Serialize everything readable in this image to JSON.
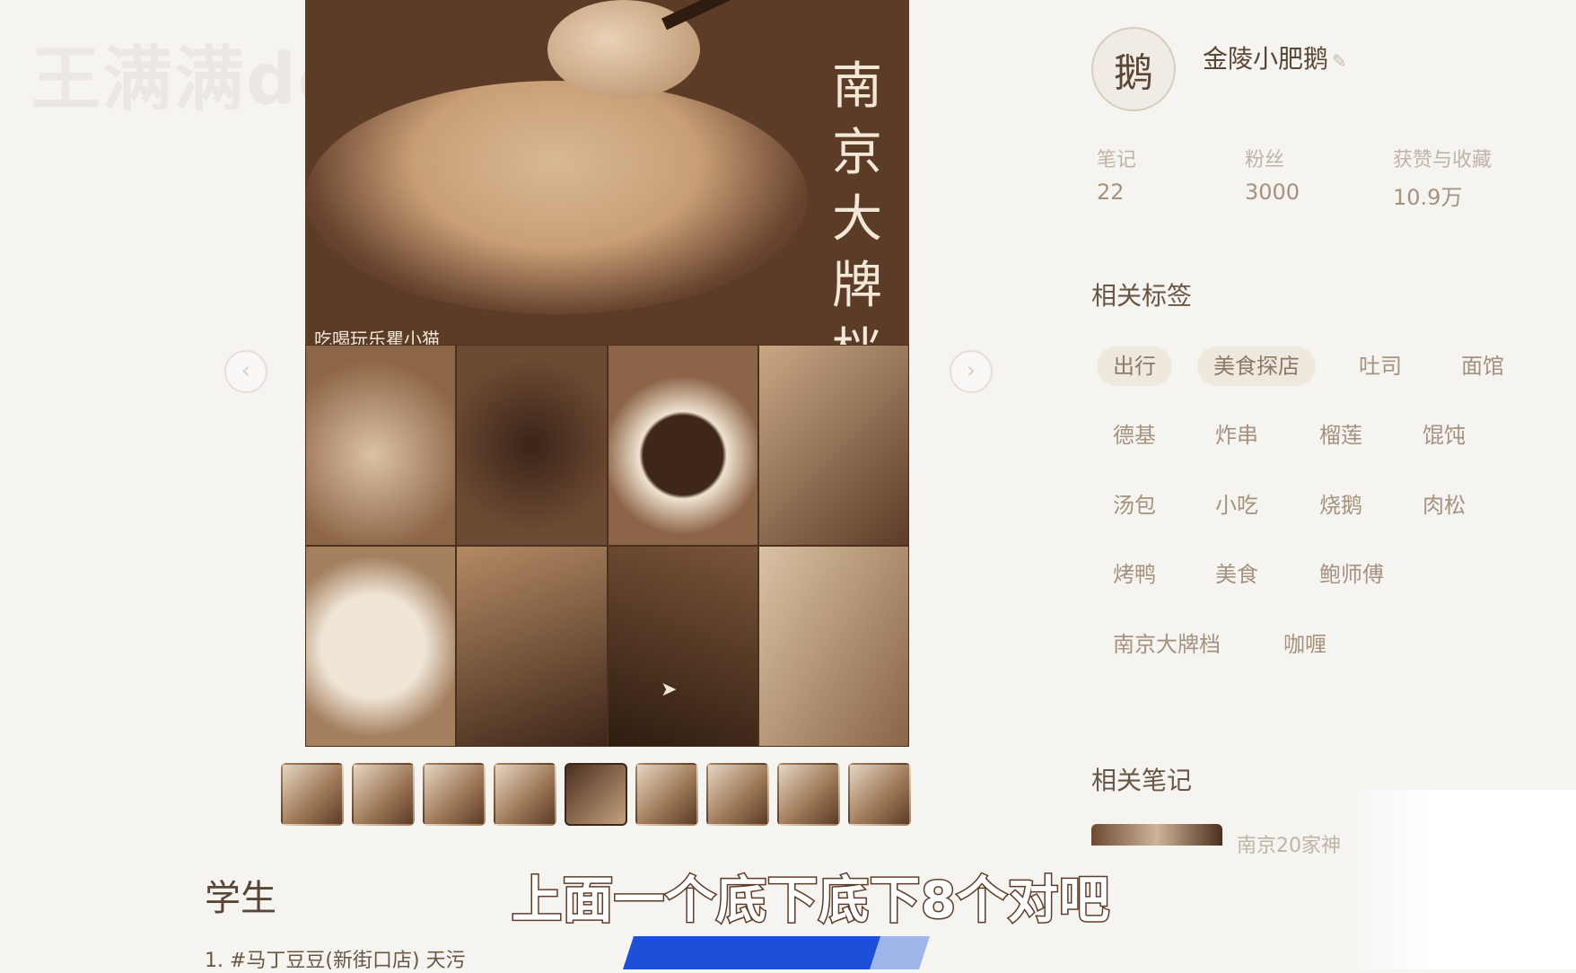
{
  "watermark": "王满满de",
  "main_image": {
    "title_vertical": "南京大牌档",
    "subtitle": "吃喝玩乐瞿小猫"
  },
  "nav": {
    "prev": "‹",
    "next": "›"
  },
  "thumbnails": {
    "count": 9,
    "active_index": 4
  },
  "note": {
    "title": "学生",
    "body_line1": "1. #马丁豆豆(新街口店) 天污"
  },
  "caption": "上面一个底下底下8个对吧",
  "author": {
    "name": "金陵小肥鹅",
    "avatar_glyph": "鹅",
    "verified_icon": "✎"
  },
  "stats": [
    {
      "label": "笔记",
      "value": "22"
    },
    {
      "label": "粉丝",
      "value": "3000"
    },
    {
      "label": "获赞与收藏",
      "value": "10.9万"
    }
  ],
  "tags_heading": "相关标签",
  "tags": [
    "出行",
    "美食探店",
    "吐司",
    "面馆",
    "德基",
    "炸串",
    "榴莲",
    "馄饨",
    "汤包",
    "小吃",
    "烧鹅",
    "肉松",
    "烤鸭",
    "美食",
    "鲍师傅",
    "南京大牌档",
    "咖喱"
  ],
  "related_heading": "相关笔记",
  "related_note_text": "南京20家神"
}
